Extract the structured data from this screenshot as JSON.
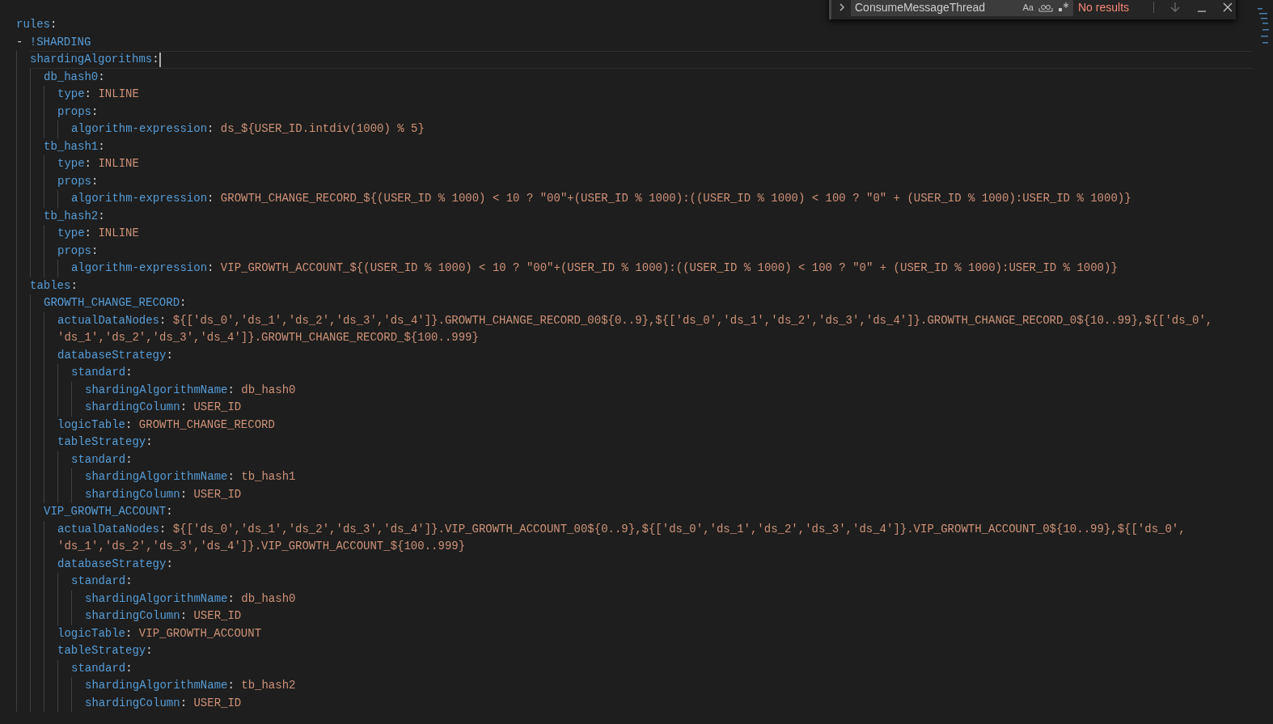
{
  "editor": {
    "lines": [
      {
        "key": "rules",
        "punct": ":",
        "children": [
          {
            "kind": "list_item",
            "marker": "-",
            "tag": "!SHARDING",
            "children": [
              {
                "key": "shardingAlgorithms",
                "punct": ":",
                "current": true,
                "children": [
                  {
                    "key": "db_hash0",
                    "punct": ":",
                    "children": [
                      {
                        "key": "type",
                        "punct": ":",
                        "value_lines": [
                          "INLINE"
                        ]
                      },
                      {
                        "key": "props",
                        "punct": ":",
                        "children": [
                          {
                            "key": "algorithm-expression",
                            "punct": ":",
                            "value_lines": [
                              "ds_${USER_ID.intdiv(1000) % 5}"
                            ]
                          }
                        ]
                      }
                    ]
                  },
                  {
                    "key": "tb_hash1",
                    "punct": ":",
                    "children": [
                      {
                        "key": "type",
                        "punct": ":",
                        "value_lines": [
                          "INLINE"
                        ]
                      },
                      {
                        "key": "props",
                        "punct": ":",
                        "children": [
                          {
                            "key": "algorithm-expression",
                            "punct": ":",
                            "value_lines": [
                              "GROWTH_CHANGE_RECORD_${(USER_ID % 1000) < 10 ? \"00\"+(USER_ID % 1000):((USER_ID % 1000) < 100 ? \"0\" + (USER_ID % 1000):USER_ID % 1000)}"
                            ]
                          }
                        ]
                      }
                    ]
                  },
                  {
                    "key": "tb_hash2",
                    "punct": ":",
                    "children": [
                      {
                        "key": "type",
                        "punct": ":",
                        "value_lines": [
                          "INLINE"
                        ]
                      },
                      {
                        "key": "props",
                        "punct": ":",
                        "children": [
                          {
                            "key": "algorithm-expression",
                            "punct": ":",
                            "value_lines": [
                              "VIP_GROWTH_ACCOUNT_${(USER_ID % 1000) < 10 ? \"00\"+(USER_ID % 1000):((USER_ID % 1000) < 100 ? \"0\" + (USER_ID % 1000):USER_ID % 1000)}"
                            ]
                          }
                        ]
                      }
                    ]
                  }
                ]
              },
              {
                "key": "tables",
                "punct": ":",
                "children": [
                  {
                    "key": "GROWTH_CHANGE_RECORD",
                    "punct": ":",
                    "children": [
                      {
                        "key": "actualDataNodes",
                        "punct": ":",
                        "value_lines": [
                          "${['ds_0','ds_1','ds_2','ds_3','ds_4']}.GROWTH_CHANGE_RECORD_00${0..9},${['ds_0','ds_1','ds_2','ds_3','ds_4']}.GROWTH_CHANGE_RECORD_0${10..99},${['ds_0',",
                          "'ds_1','ds_2','ds_3','ds_4']}.GROWTH_CHANGE_RECORD_${100..999}"
                        ]
                      },
                      {
                        "key": "databaseStrategy",
                        "punct": ":",
                        "children": [
                          {
                            "key": "standard",
                            "punct": ":",
                            "children": [
                              {
                                "key": "shardingAlgorithmName",
                                "punct": ":",
                                "value_lines": [
                                  "db_hash0"
                                ]
                              },
                              {
                                "key": "shardingColumn",
                                "punct": ":",
                                "value_lines": [
                                  "USER_ID"
                                ]
                              }
                            ]
                          }
                        ]
                      },
                      {
                        "key": "logicTable",
                        "punct": ":",
                        "value_lines": [
                          "GROWTH_CHANGE_RECORD"
                        ]
                      },
                      {
                        "key": "tableStrategy",
                        "punct": ":",
                        "children": [
                          {
                            "key": "standard",
                            "punct": ":",
                            "children": [
                              {
                                "key": "shardingAlgorithmName",
                                "punct": ":",
                                "value_lines": [
                                  "tb_hash1"
                                ]
                              },
                              {
                                "key": "shardingColumn",
                                "punct": ":",
                                "value_lines": [
                                  "USER_ID"
                                ]
                              }
                            ]
                          }
                        ]
                      }
                    ]
                  },
                  {
                    "key": "VIP_GROWTH_ACCOUNT",
                    "punct": ":",
                    "children": [
                      {
                        "key": "actualDataNodes",
                        "punct": ":",
                        "value_lines": [
                          "${['ds_0','ds_1','ds_2','ds_3','ds_4']}.VIP_GROWTH_ACCOUNT_00${0..9},${['ds_0','ds_1','ds_2','ds_3','ds_4']}.VIP_GROWTH_ACCOUNT_0${10..99},${['ds_0',",
                          "'ds_1','ds_2','ds_3','ds_4']}.VIP_GROWTH_ACCOUNT_${100..999}"
                        ]
                      },
                      {
                        "key": "databaseStrategy",
                        "punct": ":",
                        "children": [
                          {
                            "key": "standard",
                            "punct": ":",
                            "children": [
                              {
                                "key": "shardingAlgorithmName",
                                "punct": ":",
                                "value_lines": [
                                  "db_hash0"
                                ]
                              },
                              {
                                "key": "shardingColumn",
                                "punct": ":",
                                "value_lines": [
                                  "USER_ID"
                                ]
                              }
                            ]
                          }
                        ]
                      },
                      {
                        "key": "logicTable",
                        "punct": ":",
                        "value_lines": [
                          "VIP_GROWTH_ACCOUNT"
                        ]
                      },
                      {
                        "key": "tableStrategy",
                        "punct": ":",
                        "children": [
                          {
                            "key": "standard",
                            "punct": ":",
                            "children": [
                              {
                                "key": "shardingAlgorithmName",
                                "punct": ":",
                                "value_lines": [
                                  "tb_hash2"
                                ]
                              },
                              {
                                "key": "shardingColumn",
                                "punct": ":",
                                "value_lines": [
                                  "USER_ID"
                                ]
                              }
                            ]
                          }
                        ]
                      }
                    ]
                  }
                ]
              }
            ]
          }
        ]
      }
    ]
  },
  "find_widget": {
    "query": "ConsumeMessageThread",
    "match_case": "Aa",
    "result": "No results"
  }
}
